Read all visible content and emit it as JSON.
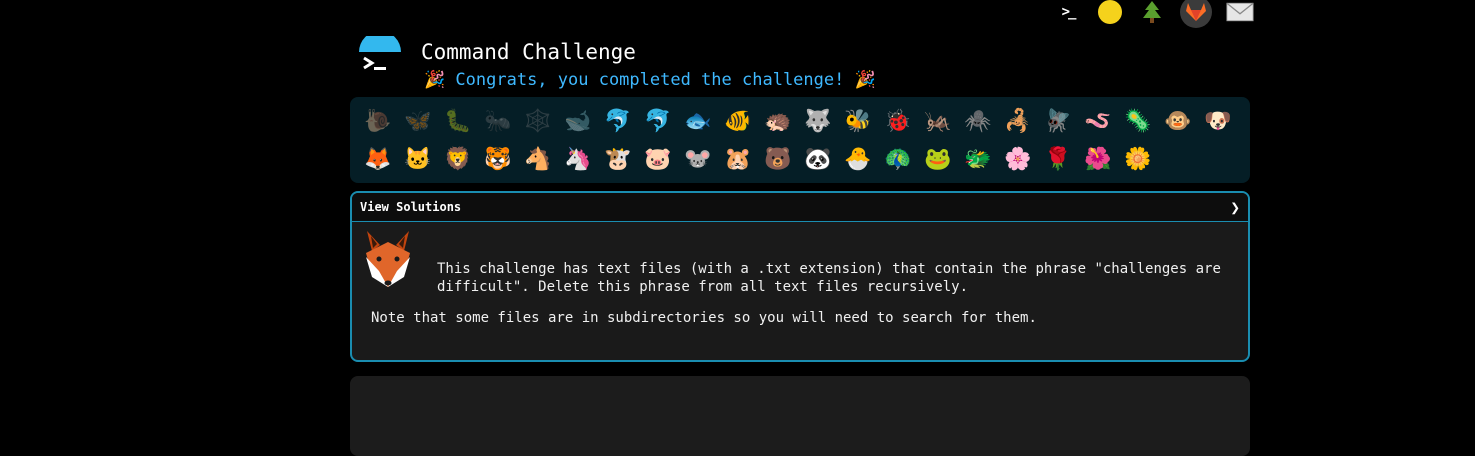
{
  "top_icons": [
    {
      "name": "prompt-icon",
      "glyph": ">_"
    },
    {
      "name": "face-icon",
      "glyph": ""
    },
    {
      "name": "tree-icon",
      "glyph": ""
    },
    {
      "name": "gitlab-icon",
      "glyph": ""
    },
    {
      "name": "mail-icon",
      "glyph": ""
    }
  ],
  "header": {
    "title": "Command Challenge",
    "subtitle": "Congrats, you completed the challenge!",
    "party_left": "🎉",
    "party_right": "🎉"
  },
  "critters": {
    "row1": [
      "🐌",
      "🦋",
      "🐛",
      "🐜",
      "🕸️",
      "🐋",
      "🐬",
      "🐬",
      "🐟",
      "🐠",
      "🦔",
      "🐺",
      "🐝",
      "🐞",
      "🦗",
      "🕷️",
      "🦂",
      "🪰",
      "🪱",
      "🦠",
      "🐵",
      "🐶"
    ],
    "row2": [
      "🦊",
      "🐱",
      "🦁",
      "🐯",
      "🐴",
      "🦄",
      "🐮",
      "🐷",
      "🐭",
      "🐹",
      "🐻",
      "🐼",
      "🐣",
      "🦚",
      "🐸",
      "🐲",
      "🌸",
      "🌹",
      "🌺",
      "🌼"
    ]
  },
  "panel": {
    "title": "View Solutions",
    "chevron": "❯",
    "description": "This challenge has text files (with a .txt extension) that contain the phrase \"challenges are difficult\". Delete this phrase from all text files recursively.",
    "note": "Note that some files are in subdirectories so you will need to search for them."
  },
  "colors": {
    "accent": "#1a8db0",
    "subtitle": "#3fb9ff",
    "critter_bg": "#051e26"
  }
}
